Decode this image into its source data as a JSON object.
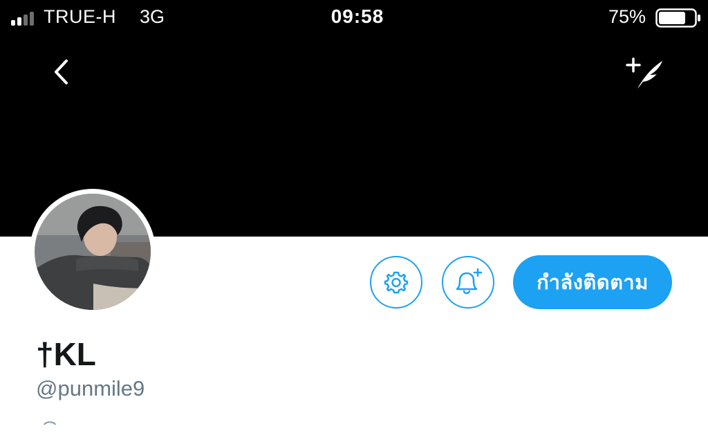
{
  "status_bar": {
    "carrier": "TRUE-H",
    "network": "3G",
    "time": "09:58",
    "battery_percent": "75%",
    "battery_level": 0.75,
    "signal_bars_active": 2
  },
  "nav": {
    "back_icon": "chevron-left-icon",
    "compose_icon": "compose-tweet-icon"
  },
  "profile": {
    "display_name": "†KL",
    "handle": "@punmile9",
    "follow_button_label": "กำลังติดตาม",
    "settings_icon": "gear-icon",
    "notify_icon": "bell-plus-icon"
  },
  "colors": {
    "header_bg": "#000000",
    "accent": "#1da1f2",
    "name_text": "#14171a",
    "handle_text": "#657786"
  }
}
